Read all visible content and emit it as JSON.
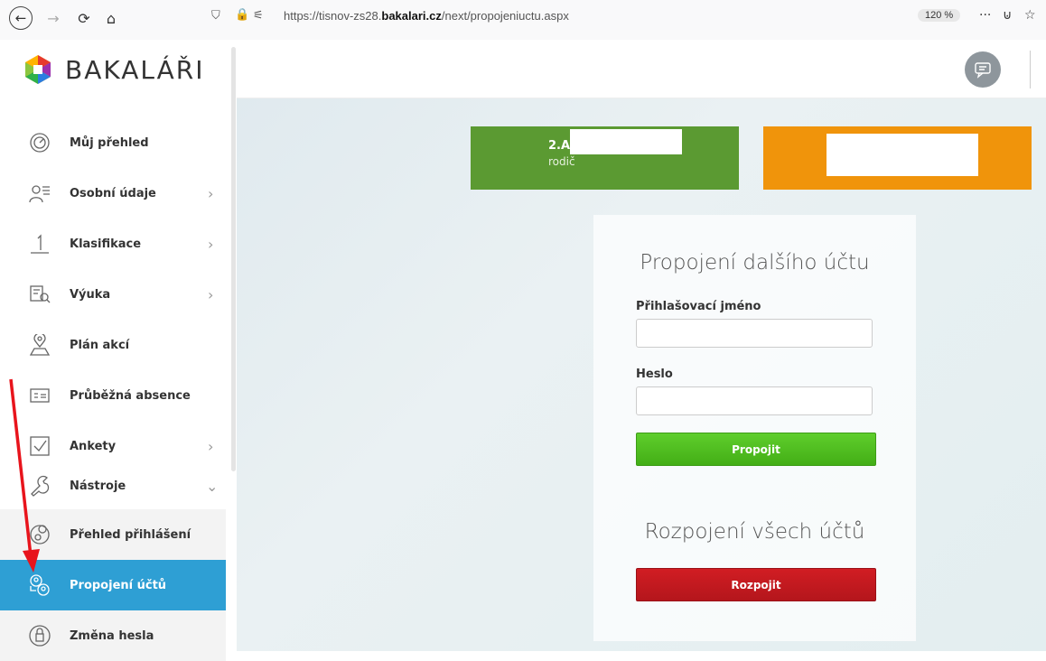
{
  "browser": {
    "url_prefix": "https://tisnov-zs28.",
    "url_domain": "bakalari.cz",
    "url_path": "/next/propojeniuctu.aspx",
    "zoom": "120 %"
  },
  "brand": {
    "name": "BAKALÁŘI"
  },
  "sidebar": {
    "items": [
      {
        "label": "Můj přehled",
        "icon": "speedometer-icon"
      },
      {
        "label": "Osobní údaje",
        "icon": "person-card-icon"
      },
      {
        "label": "Klasifikace",
        "icon": "grade-one-icon"
      },
      {
        "label": "Výuka",
        "icon": "book-search-icon"
      },
      {
        "label": "Plán akcí",
        "icon": "location-person-icon"
      },
      {
        "label": "Průběžná absence",
        "icon": "id-card-icon"
      },
      {
        "label": "Ankety",
        "icon": "checkbox-icon"
      },
      {
        "label": "Nástroje",
        "icon": "wrench-icon"
      },
      {
        "label": "Přehled přihlášení",
        "icon": "login-overview-icon"
      },
      {
        "label": "Propojení účtů",
        "icon": "linked-accounts-icon"
      },
      {
        "label": "Změna hesla",
        "icon": "lock-change-icon"
      }
    ]
  },
  "tiles": {
    "green": {
      "class": "2.A,",
      "role": "rodič"
    }
  },
  "form": {
    "link_title": "Propojení dalšího účtu",
    "username_label": "Přihlašovací jméno",
    "password_label": "Heslo",
    "link_button": "Propojit",
    "unlink_title": "Rozpojení všech účtů",
    "unlink_button": "Rozpojit"
  },
  "colors": {
    "active_nav": "#2e9fd4",
    "tile_green": "#5b9a32",
    "tile_orange": "#f0940b",
    "button_green": "#4cba1e",
    "button_red": "#c4191f",
    "annotation_arrow": "#e8141c"
  }
}
